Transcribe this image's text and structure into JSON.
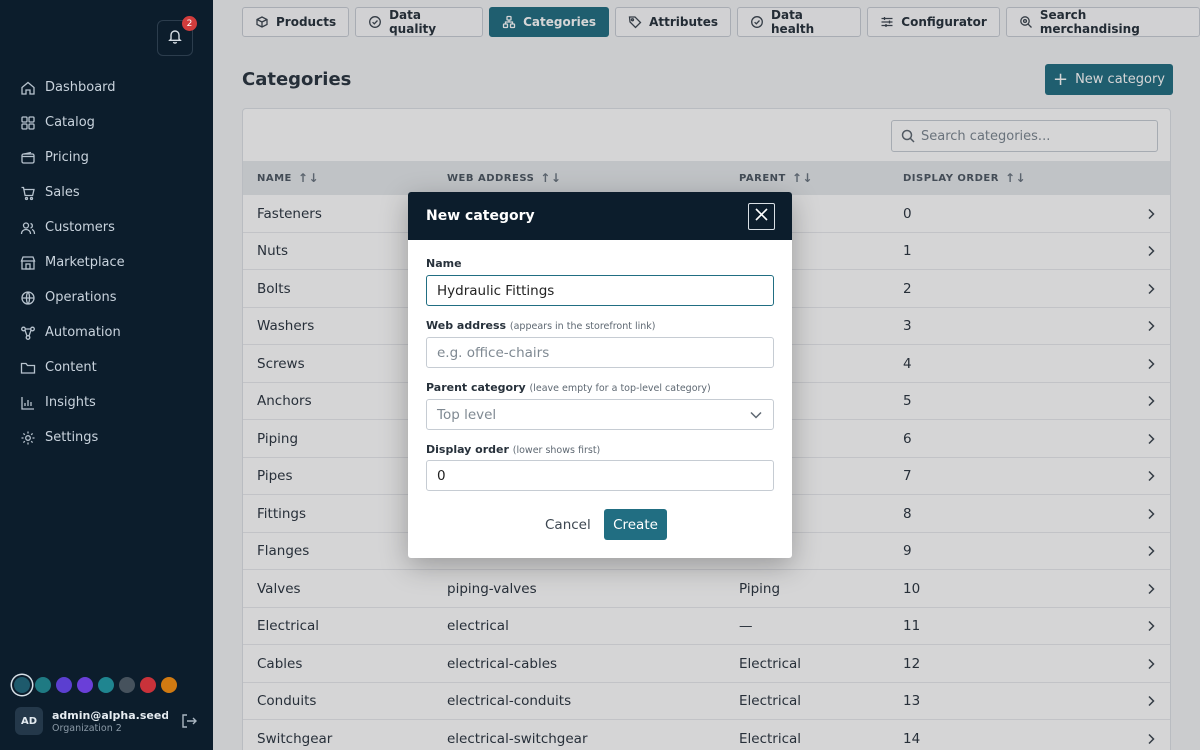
{
  "sidebar": {
    "notifications_count": "2",
    "nav": [
      {
        "label": "Dashboard",
        "icon": "home-icon"
      },
      {
        "label": "Catalog",
        "icon": "grid-icon"
      },
      {
        "label": "Pricing",
        "icon": "wallet-icon"
      },
      {
        "label": "Sales",
        "icon": "cart-icon"
      },
      {
        "label": "Customers",
        "icon": "users-icon"
      },
      {
        "label": "Marketplace",
        "icon": "store-icon"
      },
      {
        "label": "Operations",
        "icon": "globe-icon"
      },
      {
        "label": "Automation",
        "icon": "workflow-icon"
      },
      {
        "label": "Content",
        "icon": "folder-icon"
      },
      {
        "label": "Insights",
        "icon": "bar-chart-icon"
      },
      {
        "label": "Settings",
        "icon": "gear-icon"
      }
    ],
    "theme_colors": [
      "#1e5a6c",
      "#1f7a83",
      "#5b3fd0",
      "#6a3fd8",
      "#1f8590",
      "#46525d",
      "#c9323a",
      "#d17a12"
    ],
    "user": {
      "initials": "AD",
      "email": "admin@alpha.seed....",
      "org": "Organization 2"
    }
  },
  "tabs": [
    {
      "label": "Products",
      "icon": "box-icon",
      "active": false
    },
    {
      "label": "Data quality",
      "icon": "check-circle-icon",
      "active": false
    },
    {
      "label": "Categories",
      "icon": "hierarchy-icon",
      "active": true
    },
    {
      "label": "Attributes",
      "icon": "tag-icon",
      "active": false
    },
    {
      "label": "Data health",
      "icon": "check-circle-icon",
      "active": false
    },
    {
      "label": "Configurator",
      "icon": "sliders-icon",
      "active": false
    },
    {
      "label": "Search merchandising",
      "icon": "search-cog-icon",
      "active": false
    }
  ],
  "page": {
    "title": "Categories",
    "new_button": "New category",
    "search_placeholder": "Search categories..."
  },
  "table": {
    "columns": [
      "NAME",
      "WEB ADDRESS",
      "PARENT",
      "DISPLAY ORDER"
    ],
    "rows": [
      {
        "name": "Fasteners",
        "web": "",
        "parent": "",
        "order": "0"
      },
      {
        "name": "Nuts",
        "web": "",
        "parent": "s",
        "order": "1"
      },
      {
        "name": "Bolts",
        "web": "",
        "parent": "s",
        "order": "2"
      },
      {
        "name": "Washers",
        "web": "",
        "parent": "s",
        "order": "3"
      },
      {
        "name": "Screws",
        "web": "",
        "parent": "s",
        "order": "4"
      },
      {
        "name": "Anchors",
        "web": "",
        "parent": "s",
        "order": "5"
      },
      {
        "name": "Piping",
        "web": "",
        "parent": "",
        "order": "6"
      },
      {
        "name": "Pipes",
        "web": "",
        "parent": "",
        "order": "7"
      },
      {
        "name": "Fittings",
        "web": "",
        "parent": "",
        "order": "8"
      },
      {
        "name": "Flanges",
        "web": "",
        "parent": "",
        "order": "9"
      },
      {
        "name": "Valves",
        "web": "piping-valves",
        "parent": "Piping",
        "order": "10"
      },
      {
        "name": "Electrical",
        "web": "electrical",
        "parent": "—",
        "order": "11"
      },
      {
        "name": "Cables",
        "web": "electrical-cables",
        "parent": "Electrical",
        "order": "12"
      },
      {
        "name": "Conduits",
        "web": "electrical-conduits",
        "parent": "Electrical",
        "order": "13"
      },
      {
        "name": "Switchgear",
        "web": "electrical-switchgear",
        "parent": "Electrical",
        "order": "14"
      }
    ]
  },
  "modal": {
    "title": "New category",
    "name_label": "Name",
    "name_value": "Hydraulic Fittings",
    "web_label": "Web address",
    "web_hint": "(appears in the storefront link)",
    "web_placeholder": "e.g. office-chairs",
    "parent_label": "Parent category",
    "parent_hint": "(leave empty for a top-level category)",
    "parent_value": "Top level",
    "order_label": "Display order",
    "order_hint": "(lower shows first)",
    "order_value": "0",
    "cancel_label": "Cancel",
    "create_label": "Create"
  }
}
